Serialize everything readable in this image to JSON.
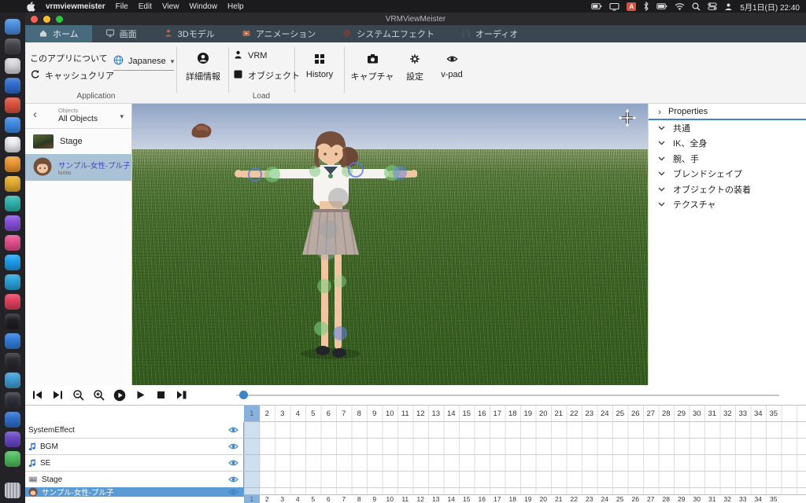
{
  "menu_bar": {
    "app_name": "vrmviewmeister",
    "items": [
      "File",
      "Edit",
      "View",
      "Window",
      "Help"
    ],
    "status_icons": [
      "battery-icon",
      "display-icon",
      "input-source-badge",
      "bluetooth-icon",
      "battery-percent-icon",
      "wifi-icon",
      "search-icon",
      "control-center-icon",
      "user-switch-icon"
    ],
    "clock": "5月1日(日) 22:40"
  },
  "window": {
    "title": "VRMViewMeister"
  },
  "tabs": [
    {
      "label": "ホーム",
      "selected": true
    },
    {
      "label": "画面",
      "selected": false
    },
    {
      "label": "3Dモデル",
      "selected": false
    },
    {
      "label": "アニメーション",
      "selected": false
    },
    {
      "label": "システムエフェクト",
      "selected": false
    },
    {
      "label": "オーディオ",
      "selected": false
    }
  ],
  "ribbon": {
    "about": "このアプリについて",
    "cache_clear": "キャッシュクリア",
    "language": {
      "value": "Japanese"
    },
    "detail_info": "詳細情報",
    "vrm": "VRM",
    "object": "オブジェクト",
    "history": "History",
    "capture": "キャプチャ",
    "settings": "設定",
    "vpad": "v-pad",
    "groups": {
      "application": "Application",
      "load": "Load"
    }
  },
  "object_panel": {
    "filter_caption": "Objects",
    "filter_value": "All Objects",
    "items": [
      {
        "label": "Stage",
        "selected": false
      },
      {
        "label": "サンプル-女性-プル子",
        "sub": "lumis",
        "selected": true
      }
    ]
  },
  "properties_panel": {
    "title": "Properties",
    "sections": [
      "共通",
      "IK、全身",
      "腕、手",
      "ブレンドシェイプ",
      "オブジェクトの装着",
      "テクスチャ"
    ]
  },
  "timeline": {
    "current_frame": 1,
    "frame_numbers": [
      1,
      2,
      3,
      4,
      5,
      6,
      7,
      8,
      9,
      10,
      11,
      12,
      13,
      14,
      15,
      16,
      17,
      18,
      19,
      20,
      21,
      22,
      23,
      24,
      25,
      26,
      27,
      28,
      29,
      30,
      31,
      32,
      33,
      34,
      35
    ],
    "tracks": [
      {
        "label": "SystemEffect",
        "icon": "none",
        "selected": false
      },
      {
        "label": "BGM",
        "icon": "audio",
        "selected": false
      },
      {
        "label": "SE",
        "icon": "audio",
        "selected": false
      },
      {
        "label": "Stage",
        "icon": "stage",
        "selected": false
      },
      {
        "label": "サンプル-女性-プル子",
        "icon": "avatar",
        "selected": true
      }
    ]
  },
  "dock": {
    "colors": [
      "#4a8fe0",
      "#44444c",
      "#dcdce2",
      "#2f6fd4",
      "#e0523f",
      "#3f8de8",
      "#f0f0f4",
      "#f09a30",
      "#e8b030",
      "#2fb8b0",
      "#8a50e0",
      "#e85090",
      "#1da1f2",
      "#2aa5e0",
      "#e8405f",
      "#1e1e24",
      "#2f7fe0",
      "#2a2a30",
      "#3f9fd8",
      "#30303a",
      "#2f6fd0",
      "#6a48c8",
      "#4fc060"
    ]
  },
  "colors": {
    "accent": "#3d85c6",
    "tab_bar": "#3a4650",
    "tab_selected": "#476b7d",
    "track_selected": "#5b9bd5",
    "timeline_highlight": "#8cb6e0",
    "object_selected": "#a9c2d5"
  }
}
